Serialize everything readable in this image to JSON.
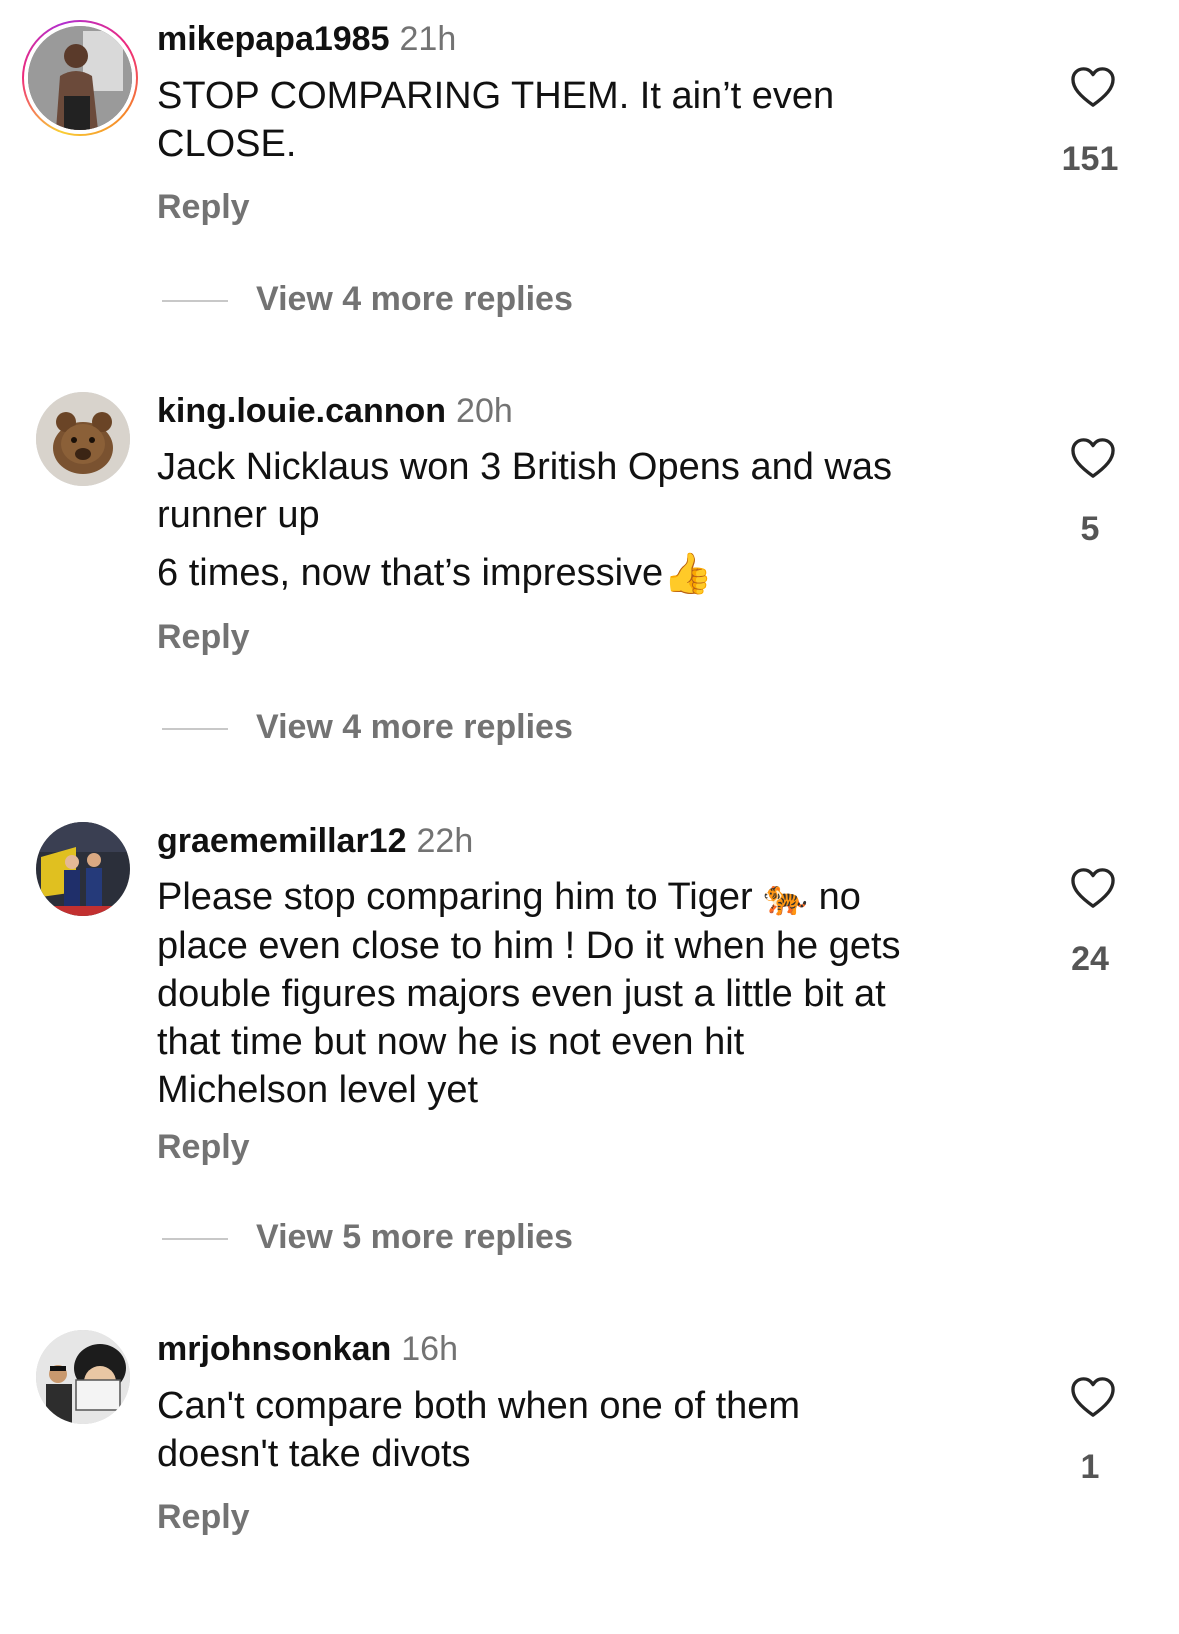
{
  "comments": [
    {
      "username": "mikepapa1985",
      "time": "21h",
      "lines": [
        "STOP COMPARING THEM. It ain’t even",
        "CLOSE."
      ],
      "likes": "151",
      "reply_label": "Reply",
      "view_more": "View 4 more replies",
      "avatar_ring": true
    },
    {
      "username": "king.louie.cannon",
      "time": "20h",
      "lines": [
        "Jack Nicklaus won 3 British Opens and was",
        "runner up"
      ],
      "line2": "6 times, now that’s impressive",
      "emoji": "👍",
      "likes": "5",
      "reply_label": "Reply",
      "view_more": "View 4 more replies"
    },
    {
      "username": "graememillar12",
      "time": "22h",
      "text_a": "Please stop comparing him to Tiger",
      "emoji": "🐅",
      "text_b": "no",
      "lines": [
        "place even close to him ! Do it when he gets",
        "double figures majors even just a little bit at",
        "that time but now he is not even hit",
        "Michelson level yet"
      ],
      "likes": "24",
      "reply_label": "Reply",
      "view_more": "View 5 more replies"
    },
    {
      "username": "mrjohnsonkan",
      "time": "16h",
      "lines": [
        "Can't compare both when one of them",
        "doesn't take divots"
      ],
      "likes": "1",
      "reply_label": "Reply"
    }
  ],
  "icons": {
    "like": "heart-outline-icon"
  },
  "colors": {
    "story_ring_a": "#f9ce34",
    "story_ring_b": "#ee2a7b",
    "muted": "#737373"
  }
}
